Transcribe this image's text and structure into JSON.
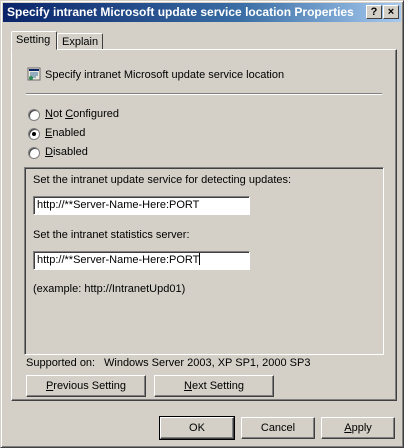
{
  "window": {
    "title": "Specify intranet Microsoft update service location Properties",
    "help_button": "?",
    "close_button": "×"
  },
  "tabs": [
    {
      "label": "Setting",
      "selected": true
    },
    {
      "label": "Explain",
      "selected": false
    }
  ],
  "policy": {
    "icon": "policy-settings-icon",
    "name": "Specify intranet Microsoft update service location"
  },
  "state_options": [
    {
      "key": "N",
      "rest": "ot ",
      "key2": "C",
      "rest2": "onfigured",
      "selected": false
    },
    {
      "key": "E",
      "rest": "nabled",
      "selected": true
    },
    {
      "key": "D",
      "rest": "isabled",
      "selected": false
    }
  ],
  "options": {
    "update_service_label": "Set the intranet update service for detecting updates:",
    "update_service_value": "http://**Server-Name-Here:PORT",
    "stats_server_label": "Set the intranet statistics server:",
    "stats_server_value": "http://**Server-Name-Here:PORT",
    "example": "(example: http://IntranetUpd01)"
  },
  "supported": {
    "label": "Supported on:",
    "value": "Windows Server 2003, XP SP1, 2000 SP3"
  },
  "nav_buttons": {
    "previous_key": "P",
    "previous_rest": "revious Setting",
    "next_key": "N",
    "next_rest": "ext Setting"
  },
  "dialog_buttons": {
    "ok": "OK",
    "cancel": "Cancel",
    "apply_key": "A",
    "apply_rest": "pply"
  }
}
